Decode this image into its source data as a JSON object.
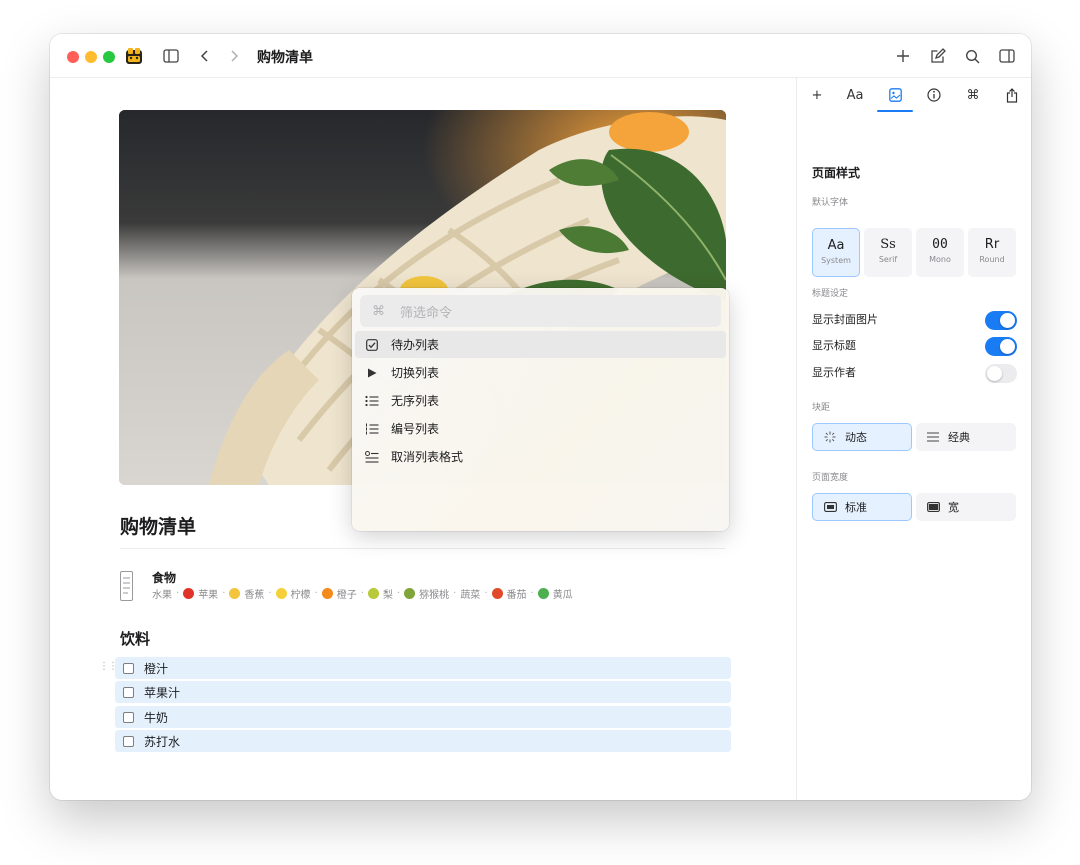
{
  "window": {
    "title": "购物清单"
  },
  "panel": {
    "tabs": {
      "add": "+",
      "typography": "Aa",
      "style": "style",
      "info": "info",
      "command": "⌘",
      "share": "share"
    },
    "page_style": "页面样式",
    "default_font": "默认字体",
    "fonts": [
      {
        "glyph": "Aa",
        "name": "System",
        "selected": true
      },
      {
        "glyph": "Ss",
        "name": "Serif",
        "selected": false
      },
      {
        "glyph": "00",
        "name": "Mono",
        "selected": false
      },
      {
        "glyph": "Rr",
        "name": "Round",
        "selected": false
      }
    ],
    "title_settings": "标题设定",
    "toggles": [
      {
        "label": "显示封面图片",
        "on": true
      },
      {
        "label": "显示标题",
        "on": true
      },
      {
        "label": "显示作者",
        "on": false
      }
    ],
    "block_spacing": "块距",
    "spacing_options": [
      "动态",
      "经典"
    ],
    "page_width": "页面宽度",
    "width_options": [
      "标准",
      "宽"
    ]
  },
  "editor": {
    "page_title": "购物清单",
    "food": {
      "title": "食物",
      "category": "水果",
      "fruits": [
        {
          "name": "苹果",
          "color": "#e0342a"
        },
        {
          "name": "香蕉",
          "color": "#f2c53d"
        },
        {
          "name": "柠檬",
          "color": "#f5d03a"
        },
        {
          "name": "橙子",
          "color": "#f28a1c"
        },
        {
          "name": "梨",
          "color": "#b8c93a"
        },
        {
          "name": "猕猴桃",
          "color": "#7ea43a"
        }
      ],
      "vegetables_label": "蔬菜",
      "vegetables": [
        {
          "name": "番茄",
          "color": "#e04a2a"
        },
        {
          "name": "黄瓜",
          "color": "#4caf50"
        }
      ]
    },
    "drinks": {
      "title": "饮料",
      "items": [
        "橙汁",
        "苹果汁",
        "牛奶",
        "苏打水"
      ]
    }
  },
  "popup": {
    "search_placeholder": "筛选命令",
    "items": [
      "待办列表",
      "切换列表",
      "无序列表",
      "编号列表",
      "取消列表格式"
    ]
  }
}
